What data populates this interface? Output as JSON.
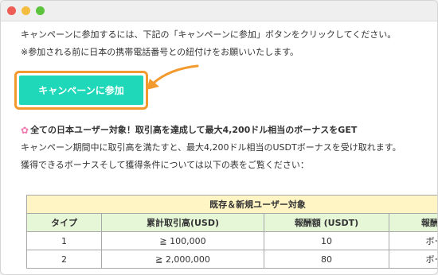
{
  "window": {
    "controls": [
      "close",
      "minimize",
      "maximize"
    ]
  },
  "intro": {
    "line1": "キャンペーンに参加するには、下記の「キャンペーンに参加」ボタンをクリックしてください。",
    "line2": "※参加される前に日本の携帯電話番号との紐付けをお願いいたします。"
  },
  "cta": {
    "label": "キャンペーンに参加"
  },
  "campaign": {
    "headline_icon": "flower-icon",
    "headline": "全ての日本ユーザー対象！取引高を達成して最大4,200ドル相当のボーナスをGET",
    "desc1": "キャンペーン期間中に取引高を満たすと、最大4,200ドル相当のUSDTボーナスを受け取れます。",
    "desc2": "獲得できるボーナスそして獲得条件については以下の表をご覧ください："
  },
  "table": {
    "caption": "既存＆新規ユーザー対象",
    "headers": [
      "タイプ",
      "累計取引高(USD)",
      "報酬額 (USDT)",
      "報酬タイ"
    ],
    "rows": [
      [
        "1",
        "≧ 100,000",
        "10",
        "ボーナ"
      ],
      [
        "2",
        "≧ 2,000,000",
        "80",
        "ボーナ"
      ]
    ]
  },
  "colors": {
    "cta_bg": "#1ed8b9",
    "cta_frame": "#f29a2e",
    "caption_bg": "#fff4c4",
    "header_bg": "#e6f7d8"
  }
}
